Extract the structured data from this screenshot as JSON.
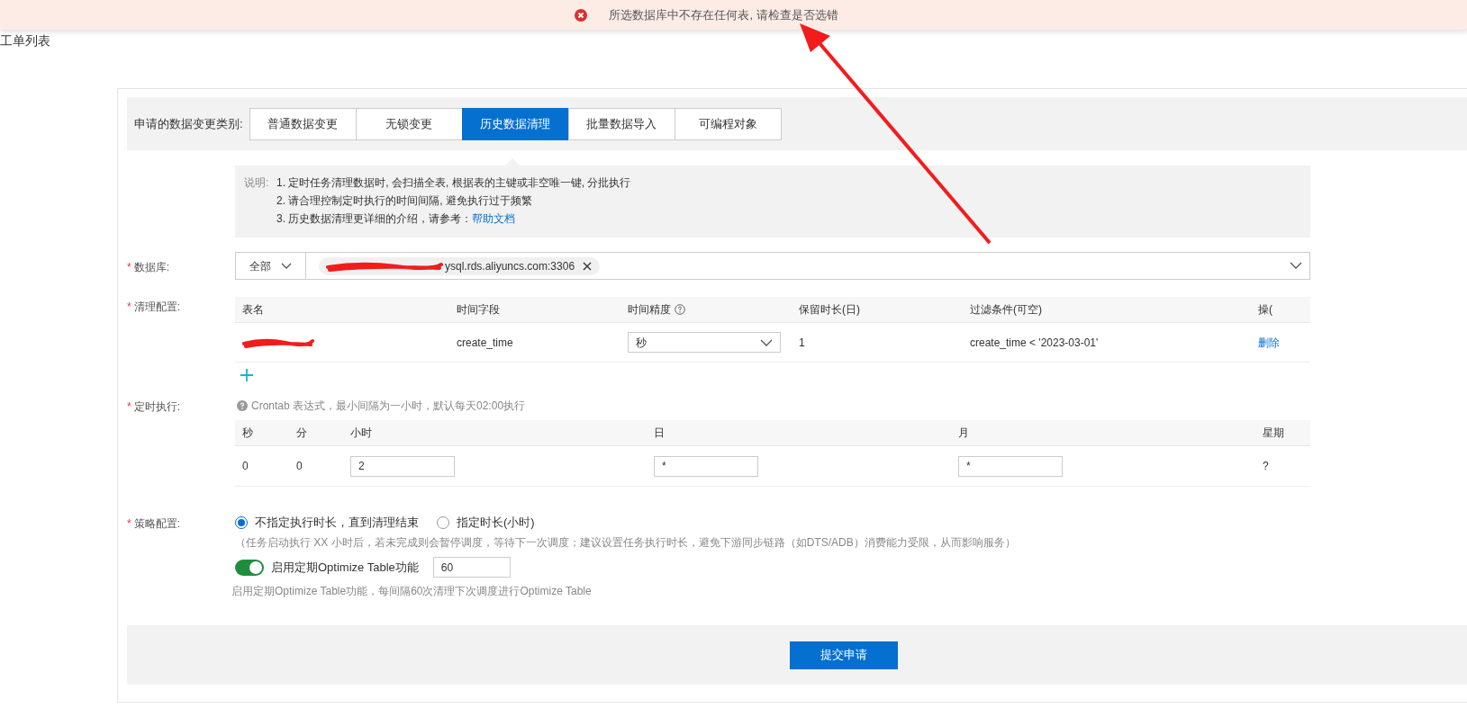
{
  "toast": {
    "kind": "error",
    "message": "所选数据库中不存在任何表, 请检查是否选错"
  },
  "page_title": "工单列表",
  "change_type": {
    "label": "申请的数据变更类别:",
    "tabs": [
      {
        "label": "普通数据变更",
        "selected": false
      },
      {
        "label": "无锁变更",
        "selected": false
      },
      {
        "label": "历史数据清理",
        "selected": true
      },
      {
        "label": "批量数据导入",
        "selected": false
      },
      {
        "label": "可编程对象",
        "selected": false
      }
    ]
  },
  "notes": {
    "label": "说明:",
    "lines": [
      "1. 定时任务清理数据时, 会扫描全表, 根据表的主键或非空唯一键, 分批执行",
      "2. 请合理控制定时执行的时间间隔, 避免执行过于频繁",
      "3. 历史数据清理更详细的介绍，请参考："
    ],
    "link": "帮助文档"
  },
  "database": {
    "label": "数据库:",
    "required": true,
    "scope": "全部",
    "tag": "ysql.rds.aliyuncs.com:3306"
  },
  "cleanup": {
    "label": "清理配置:",
    "required": true,
    "columns": [
      "表名",
      "时间字段",
      "时间精度",
      "保留时长(日)",
      "过滤条件(可空)",
      "操("
    ],
    "rows": [
      {
        "time_field": "create_time",
        "precision": "秒",
        "retention": "1",
        "filter": "create_time < '2023-03-01'",
        "action": "删除"
      }
    ]
  },
  "schedule": {
    "label": "定时执行:",
    "required": true,
    "hint": "Crontab 表达式，最小间隔为一小时，默认每天02:00执行",
    "columns": [
      "秒",
      "分",
      "小时",
      "日",
      "月",
      "星期"
    ],
    "values": [
      {
        "kind": "text",
        "value": "0"
      },
      {
        "kind": "text",
        "value": "0"
      },
      {
        "kind": "input",
        "value": "2"
      },
      {
        "kind": "input",
        "value": "*"
      },
      {
        "kind": "input",
        "value": "*"
      },
      {
        "kind": "text",
        "value": "?"
      }
    ]
  },
  "strategy": {
    "label": "策略配置:",
    "required": true,
    "options": [
      {
        "label": "不指定执行时长，直到清理结束",
        "selected": true
      },
      {
        "label": "指定时长(小时)",
        "selected": false
      }
    ],
    "hint": "（任务启动执行 XX 小时后，若未完成则会暂停调度，等待下一次调度；建议设置任务执行时长，避免下游同步链路（如DTS/ADB）消费能力受限，从而影响服务）",
    "optimize": {
      "on": true,
      "label": "启用定期Optimize Table功能",
      "value": "60"
    },
    "description": "启用定期Optimize Table功能，每间隔60次清理下次调度进行Optimize Table"
  },
  "submit": "提交申请"
}
